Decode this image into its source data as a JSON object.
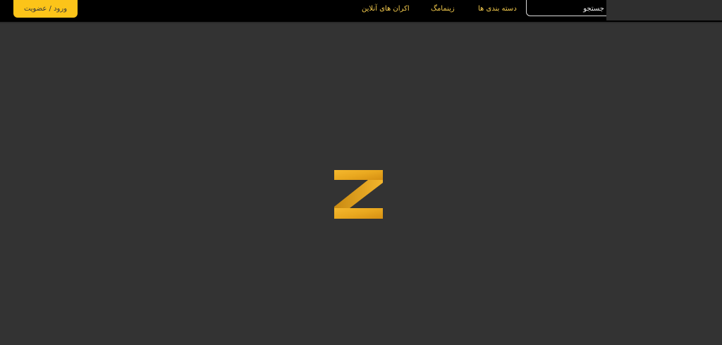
{
  "header": {
    "login_label": "ورود / عضویت",
    "nav": [
      {
        "label": "دسته بندی ها"
      },
      {
        "label": "زینمامگ"
      },
      {
        "label": "اکران های آنلاین"
      }
    ],
    "search": {
      "value": "جستجو"
    }
  },
  "colors": {
    "background": "#333333",
    "header": "#000000",
    "accent": "#fcc419",
    "nav_text": "#f2c94c"
  },
  "loader": {
    "icon": "z-logo-icon"
  }
}
